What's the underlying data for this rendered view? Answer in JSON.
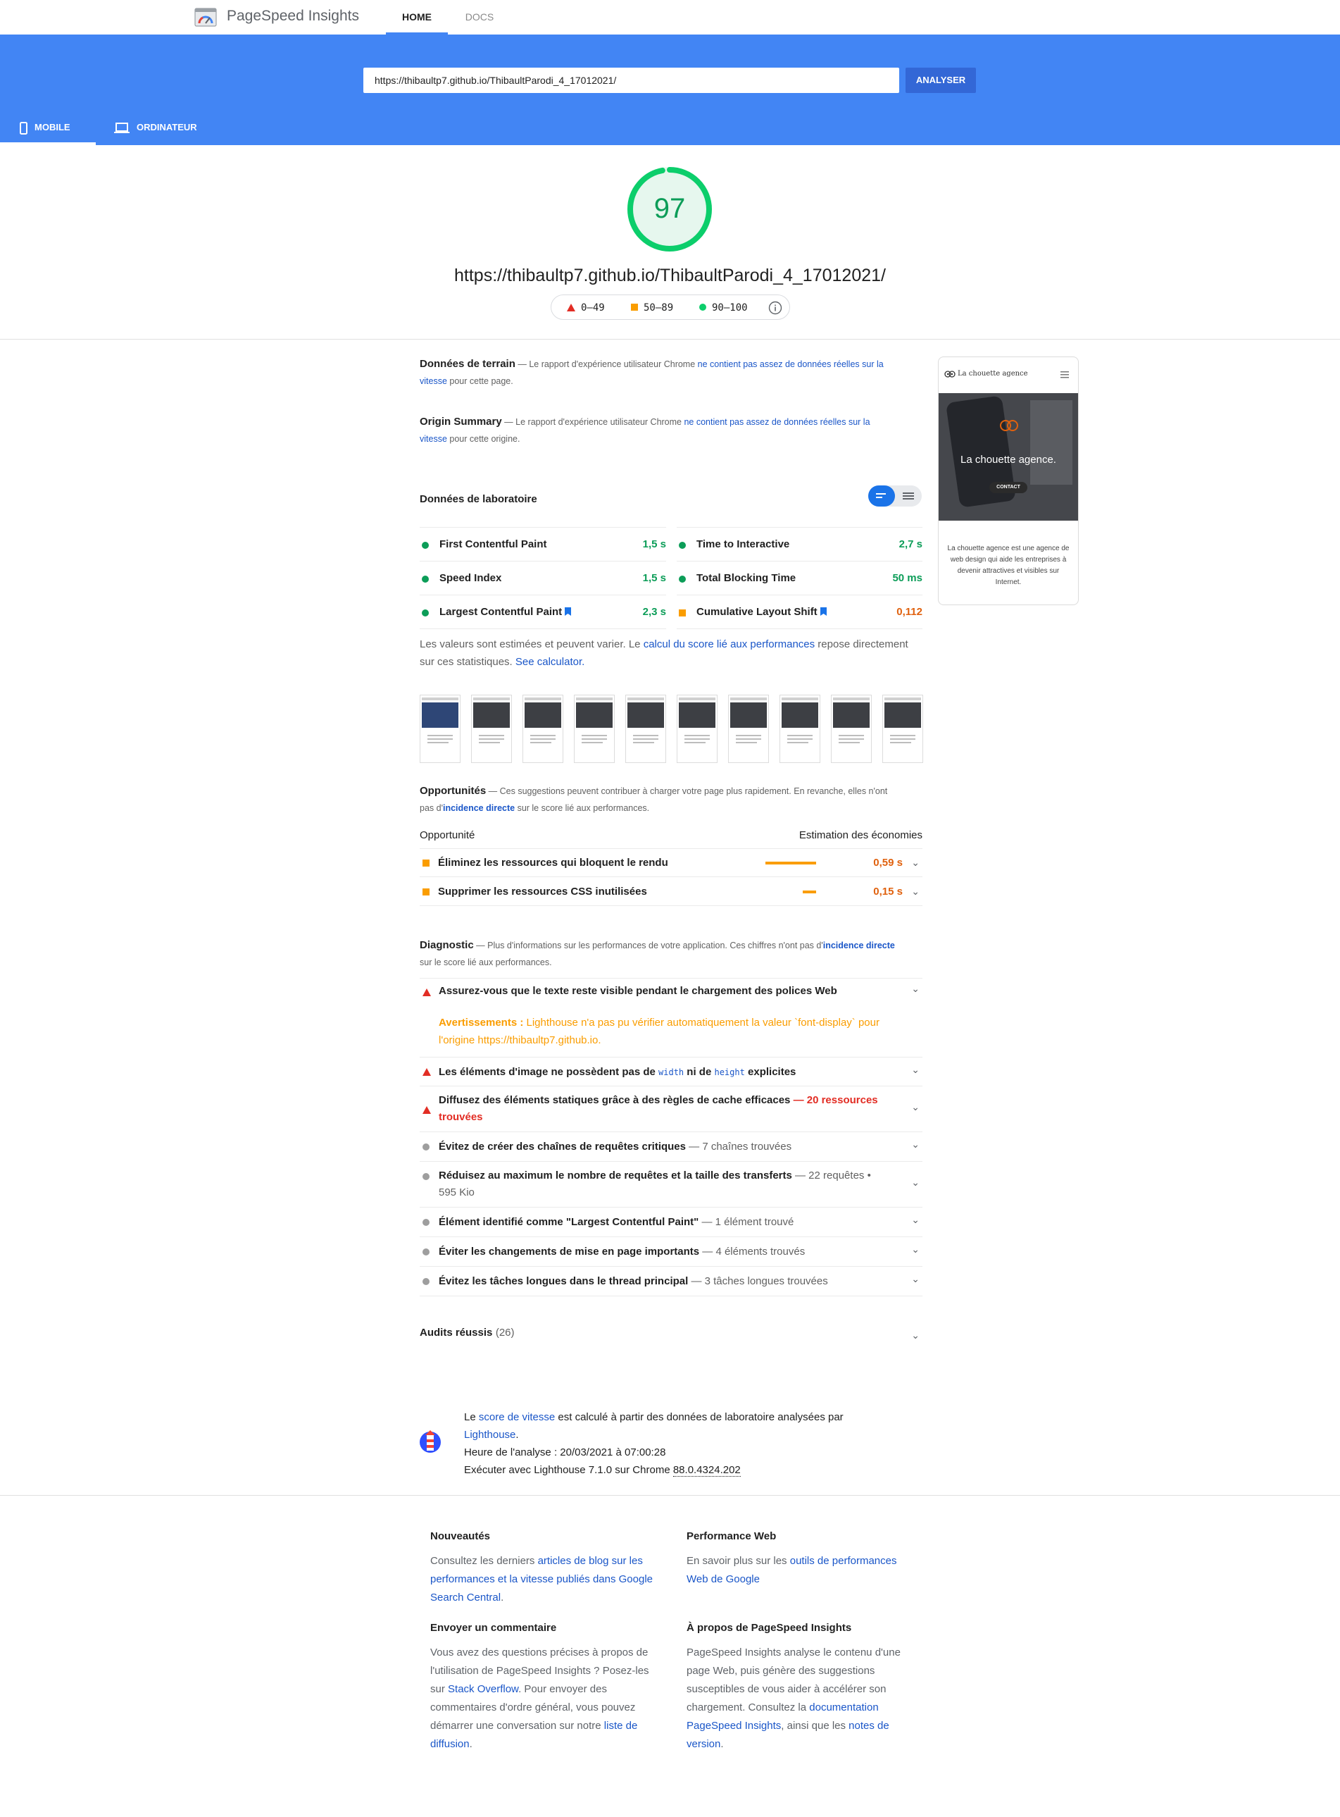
{
  "header": {
    "brand": "PageSpeed Insights",
    "nav": [
      "HOME",
      "DOCS"
    ]
  },
  "search": {
    "url_value": "https://thibaultp7.github.io/ThibaultParodi_4_17012021/",
    "button_label": "ANALYSER"
  },
  "device_tabs": [
    "MOBILE",
    "ORDINATEUR"
  ],
  "score": {
    "value": "97",
    "fraction": 0.97,
    "url": "https://thibaultp7.github.io/ThibaultParodi_4_17012021/",
    "legend": [
      "0–49",
      "50–89",
      "90–100"
    ]
  },
  "field": {
    "title": "Données de terrain",
    "dash": " — Le rapport d'expérience utilisateur Chrome ",
    "link": "ne contient pas assez de données réelles sur la vitesse",
    "tail": " pour cette page."
  },
  "origin": {
    "title": "Origin Summary",
    "dash": " — Le rapport d'expérience utilisateur Chrome ",
    "link": "ne contient pas assez de données réelles sur la vitesse",
    "tail": " pour cette origine."
  },
  "lab": {
    "title": "Données de laboratoire",
    "metrics_left": [
      {
        "label": "First Contentful Paint",
        "value": "1,5 s"
      },
      {
        "label": "Speed Index",
        "value": "1,5 s"
      },
      {
        "label": "Largest Contentful Paint",
        "value": "2,3 s"
      }
    ],
    "metrics_right": [
      {
        "label": "Time to Interactive",
        "value": "2,7 s"
      },
      {
        "label": "Total Blocking Time",
        "value": "50 ms"
      },
      {
        "label": "Cumulative Layout Shift",
        "value": "0,112"
      }
    ],
    "note_a": "Les valeurs sont estimées et peuvent varier. Le ",
    "note_link": "calcul du score lié aux performances",
    "note_b": " repose directement sur ces statistiques. ",
    "note_link2": "See calculator."
  },
  "opportunities": {
    "title": "Opportunités",
    "desc_a": " — Ces suggestions peuvent contribuer à charger votre page plus rapidement. En revanche, elles n'ont pas d'",
    "desc_link": "incidence directe",
    "desc_b": " sur le score lié aux performances.",
    "col_left": "Opportunité",
    "col_right": "Estimation des économies",
    "items": [
      {
        "label": "Éliminez les ressources qui bloquent le rendu",
        "value": "0,59 s",
        "fraction": 1.0
      },
      {
        "label": "Supprimer les ressources CSS inutilisées",
        "value": "0,15 s",
        "fraction": 0.26
      }
    ]
  },
  "diagnostic": {
    "title": "Diagnostic",
    "desc_a": " — Plus d'informations sur les performances de votre application. Ces chiffres n'ont pas d'",
    "desc_link": "incidence directe",
    "desc_b": " sur le score lié aux performances.",
    "font_item": "Assurez-vous que le texte reste visible pendant le chargement des polices Web",
    "warning_label": "Avertissements : ",
    "warning_text": "Lighthouse n'a pas pu vérifier automatiquement la valeur `font-display` pour l'origine https://thibaultp7.github.io.",
    "img_item_a": "Les éléments d'image ne possèdent pas de ",
    "img_code1": "width",
    "img_item_b": " ni de ",
    "img_code2": "height",
    "img_item_c": " explicites",
    "cache_item": "Diffusez des éléments statiques grâce à des règles de cache efficaces",
    "cache_detail": " — 20 ressources trouvées",
    "items": [
      {
        "label": "Évitez de créer des chaînes de requêtes critiques",
        "detail": " — 7 chaînes trouvées"
      },
      {
        "label": "Réduisez au maximum le nombre de requêtes et la taille des transferts",
        "detail": " — 22 requêtes • 595 Kio"
      },
      {
        "label": "Élément identifié comme \"Largest Contentful Paint\"",
        "detail": " — 1 élément trouvé"
      },
      {
        "label": "Éviter les changements de mise en page importants",
        "detail": " — 4 éléments trouvés"
      },
      {
        "label": "Évitez les tâches longues dans le thread principal",
        "detail": " — 3 tâches longues trouvées"
      }
    ]
  },
  "passed": {
    "label": "Audits réussis",
    "count": "(26)"
  },
  "about_run": {
    "a": "Le ",
    "link1": "score de vitesse",
    "b": " est calculé à partir des données de laboratoire analysées par ",
    "link2": "Lighthouse",
    "c": ".",
    "time": "Heure de l'analyse : 20/03/2021 à 07:00:28",
    "run_a": "Exécuter avec Lighthouse 7.1.0 sur Chrome ",
    "run_version": "88.0.4324.202"
  },
  "preview": {
    "site_name": "La chouette agence",
    "hero_text": "La chouette agence.",
    "cta": "CONTACT",
    "body": "La chouette agence est une agence de web design qui aide les entreprises à devenir attractives et visibles sur Internet."
  },
  "footer": {
    "news": {
      "title": "Nouveautés",
      "a": "Consultez les derniers ",
      "link": "articles de blog sur les performances et la vitesse publiés dans Google Search Central",
      "b": "."
    },
    "perf": {
      "title": "Performance Web",
      "a": "En savoir plus sur les ",
      "link": "outils de performances Web de Google"
    },
    "feedback": {
      "title": "Envoyer un commentaire",
      "a": "Vous avez des questions précises à propos de l'utilisation de PageSpeed Insights ? Posez-les sur ",
      "link1": "Stack Overflow",
      "b": ". Pour envoyer des commentaires d'ordre général, vous pouvez démarrer une conversation sur notre ",
      "link2": "liste de diffusion",
      "c": "."
    },
    "about": {
      "title": "À propos de PageSpeed Insights",
      "a": "PageSpeed Insights analyse le contenu d'une page Web, puis génère des suggestions susceptibles de vous aider à accélérer son chargement. Consultez la ",
      "link1": "documentation PageSpeed Insights",
      "b": ", ainsi que les ",
      "link2": "notes de version",
      "c": "."
    }
  },
  "colors": {
    "accent": "#4285f4",
    "pass": "#0c9d58",
    "average": "#fa9d00",
    "fail": "#e22d24"
  }
}
